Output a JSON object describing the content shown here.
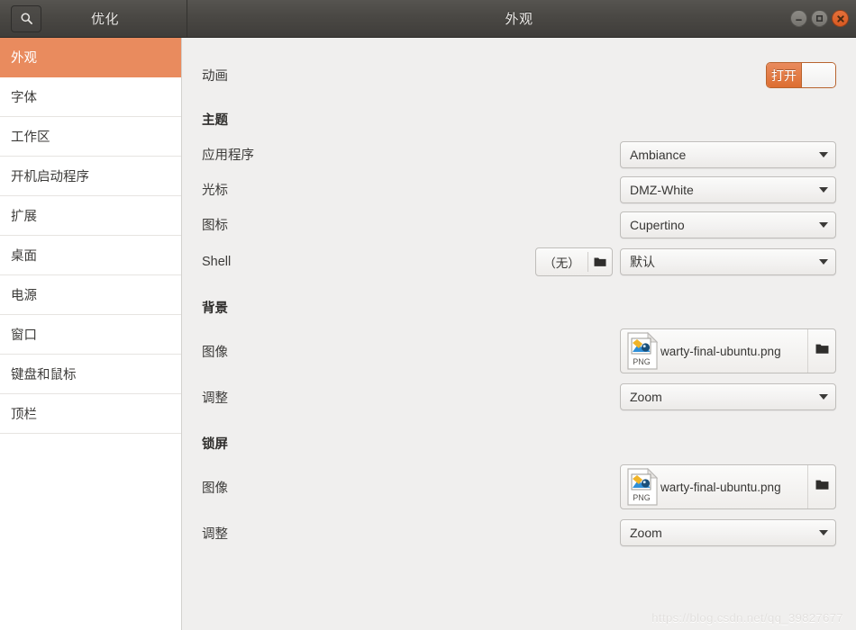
{
  "titlebar": {
    "app_name": "优化",
    "window_title": "外观",
    "search_icon": "search-icon",
    "minimize_label": "",
    "maximize_label": "",
    "close_label": ""
  },
  "sidebar": {
    "items": [
      {
        "label": "外观",
        "active": true
      },
      {
        "label": "字体",
        "active": false
      },
      {
        "label": "工作区",
        "active": false
      },
      {
        "label": "开机启动程序",
        "active": false
      },
      {
        "label": "扩展",
        "active": false
      },
      {
        "label": "桌面",
        "active": false
      },
      {
        "label": "电源",
        "active": false
      },
      {
        "label": "窗口",
        "active": false
      },
      {
        "label": "键盘和鼠标",
        "active": false
      },
      {
        "label": "顶栏",
        "active": false
      }
    ]
  },
  "content": {
    "animation": {
      "label": "动画",
      "toggle_state": "打开"
    },
    "theme_group": "主题",
    "application": {
      "label": "应用程序",
      "value": "Ambiance"
    },
    "cursor": {
      "label": "光标",
      "value": "DMZ-White"
    },
    "icons": {
      "label": "图标",
      "value": "Cupertino"
    },
    "shell": {
      "label": "Shell",
      "file_value": "（无）",
      "value": "默认"
    },
    "background_group": "背景",
    "background_image": {
      "label": "图像",
      "file_name": "warty-final-ubuntu.png",
      "file_type": "PNG"
    },
    "background_adjust": {
      "label": "调整",
      "value": "Zoom"
    },
    "lockscreen_group": "锁屏",
    "lockscreen_image": {
      "label": "图像",
      "file_name": "warty-final-ubuntu.png",
      "file_type": "PNG"
    },
    "lockscreen_adjust": {
      "label": "调整",
      "value": "Zoom"
    }
  },
  "watermark": "https://blog.csdn.net/qq_39827677"
}
